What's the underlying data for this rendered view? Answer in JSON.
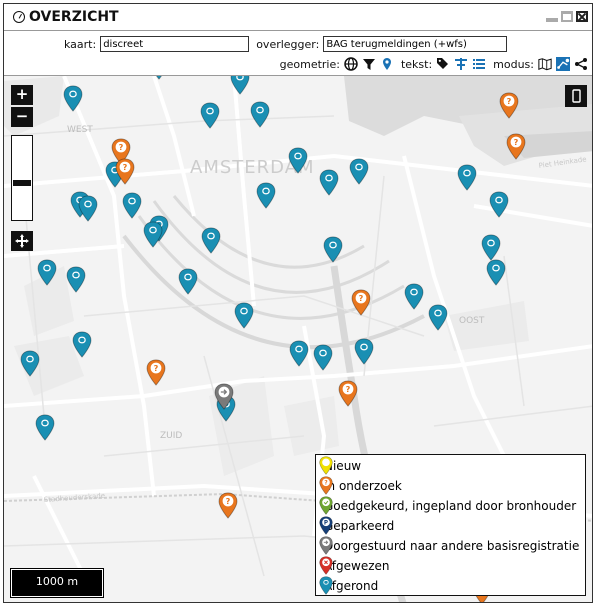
{
  "window": {
    "title": "OVERZICHT"
  },
  "controls": {
    "kaart_label": "kaart:",
    "kaart_value": "discreet",
    "overlegger_label": "overlegger:",
    "overlegger_value": "BAG terugmeldingen (+wfs)",
    "geometrie_label": "geometrie:",
    "tekst_label": "tekst:",
    "modus_label": "modus:"
  },
  "map": {
    "zoom_in": "+",
    "zoom_out": "−",
    "scale_label": "1000 m",
    "place_labels": [
      "AMSTERDAM",
      "WEST",
      "OOST",
      "ZUID",
      "Piet Heinkade",
      "Stadhouderskade"
    ]
  },
  "legend": {
    "items": [
      {
        "label": "Nieuw",
        "color": "#f0e000",
        "icon": "blank"
      },
      {
        "label": "In onderzoek",
        "color": "#e8761e",
        "icon": "question"
      },
      {
        "label": "Goedgekeurd, ingepland door bronhouder",
        "color": "#6ea531",
        "icon": "check"
      },
      {
        "label": "Geparkeerd",
        "color": "#163f78",
        "icon": "parking"
      },
      {
        "label": "Doorgestuurd naar andere basisregistratie",
        "color": "#7a7a7a",
        "icon": "arrow"
      },
      {
        "label": "Afgewezen",
        "color": "#d62f26",
        "icon": "cross"
      },
      {
        "label": "Afgerond",
        "color": "#1a8fb3",
        "icon": "dot"
      }
    ]
  },
  "markers": {
    "afgerond": [
      [
        155,
        75
      ],
      [
        236,
        90
      ],
      [
        69,
        107
      ],
      [
        206,
        124
      ],
      [
        256,
        123
      ],
      [
        111,
        183
      ],
      [
        294,
        169
      ],
      [
        325,
        191
      ],
      [
        355,
        180
      ],
      [
        262,
        204
      ],
      [
        463,
        186
      ],
      [
        495,
        213
      ],
      [
        76,
        213
      ],
      [
        84,
        217
      ],
      [
        128,
        214
      ],
      [
        155,
        237
      ],
      [
        149,
        243
      ],
      [
        207,
        249
      ],
      [
        329,
        258
      ],
      [
        487,
        256
      ],
      [
        43,
        281
      ],
      [
        72,
        288
      ],
      [
        492,
        281
      ],
      [
        184,
        290
      ],
      [
        410,
        305
      ],
      [
        240,
        324
      ],
      [
        434,
        326
      ],
      [
        78,
        353
      ],
      [
        295,
        362
      ],
      [
        319,
        366
      ],
      [
        360,
        360
      ],
      [
        26,
        372
      ],
      [
        222,
        417
      ],
      [
        41,
        436
      ]
    ],
    "onderzoek": [
      [
        505,
        114
      ],
      [
        117,
        160
      ],
      [
        121,
        180
      ],
      [
        512,
        155
      ],
      [
        357,
        311
      ],
      [
        152,
        381
      ],
      [
        344,
        402
      ],
      [
        224,
        514
      ],
      [
        478,
        600
      ]
    ],
    "doorgestuurd": [
      [
        220,
        405
      ]
    ]
  }
}
